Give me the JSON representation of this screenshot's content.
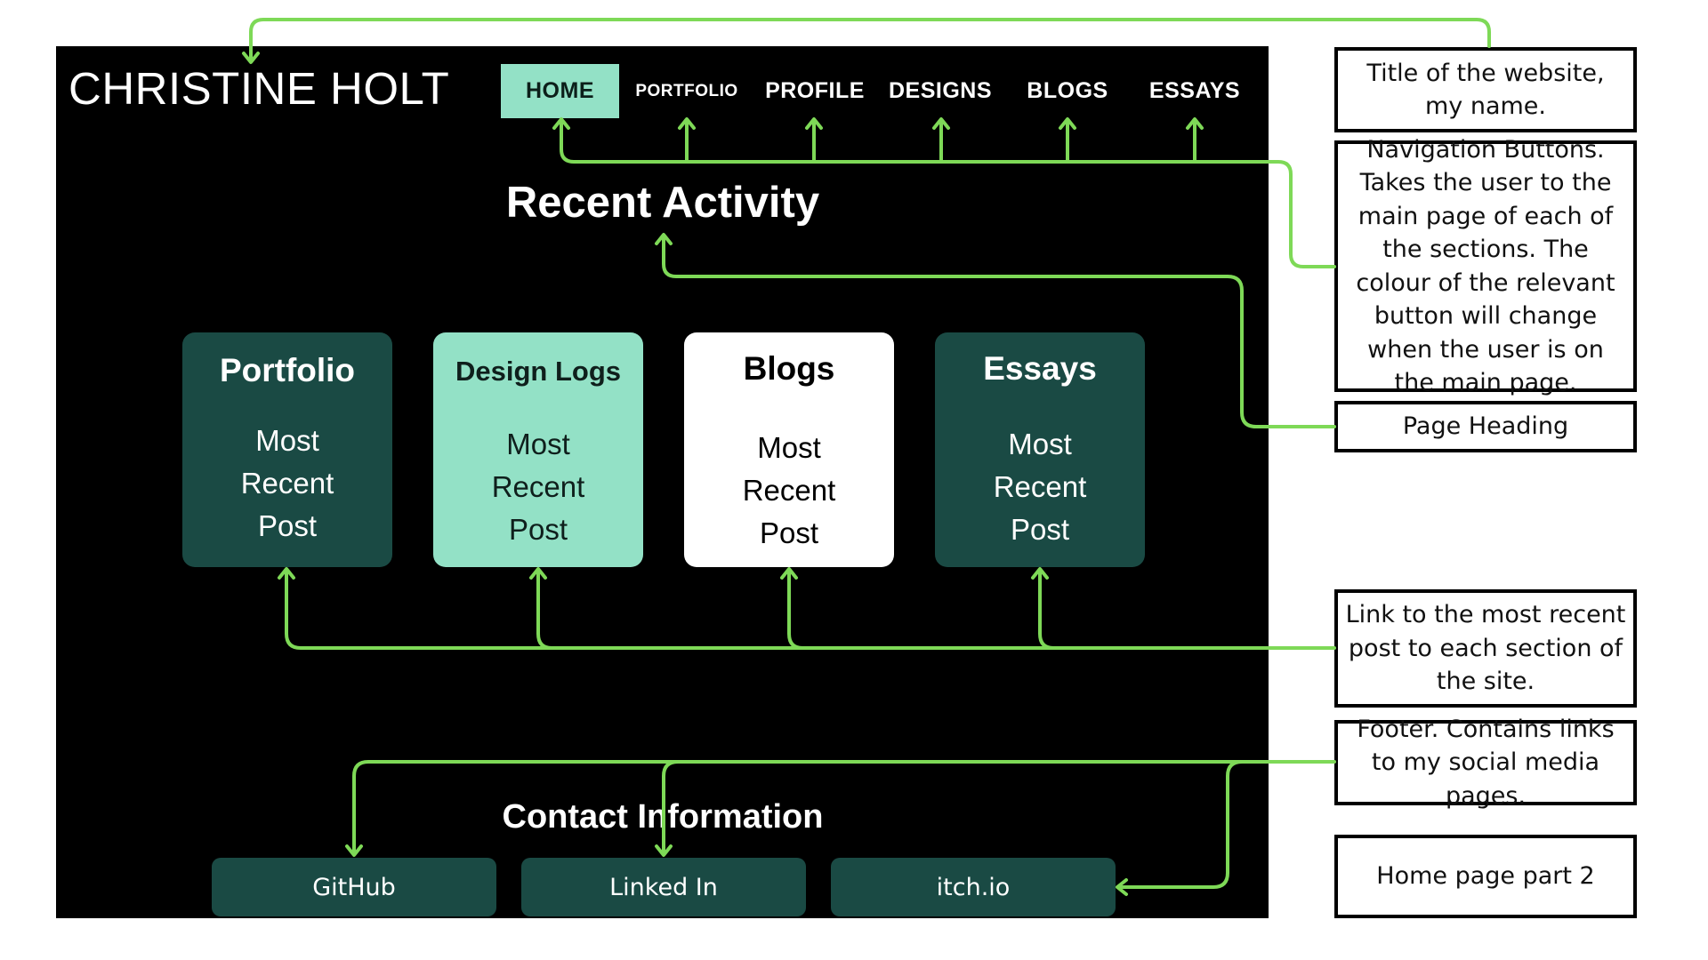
{
  "site": {
    "title": "CHRISTINE HOLT",
    "nav": [
      "HOME",
      "PORTFOLIO",
      "PROFILE",
      "DESIGNS",
      "BLOGS",
      "ESSAYS"
    ],
    "active_nav": "HOME",
    "heading": "Recent Activity",
    "cards": [
      {
        "title": "Portfolio",
        "lines": [
          "Most",
          "Recent",
          "Post"
        ],
        "style": "dark"
      },
      {
        "title": "Design Logs",
        "lines": [
          "Most",
          "Recent",
          "Post"
        ],
        "style": "mint"
      },
      {
        "title": "Blogs",
        "lines": [
          "Most",
          "Recent",
          "Post"
        ],
        "style": "white"
      },
      {
        "title": "Essays",
        "lines": [
          "Most",
          "Recent",
          "Post"
        ],
        "style": "dark"
      }
    ],
    "contact_heading": "Contact Information",
    "footer_links": [
      "GitHub",
      "Linked In",
      "itch.io"
    ]
  },
  "annotations": {
    "title_note": "Title of the website, my name.",
    "nav_note": "Navigation Buttons. Takes the user to the main page of each of the sections. The colour of the relevant button will change when the user is on the main page.",
    "heading_note": "Page Heading",
    "cards_note": "Link to the most recent post to each section of the site.",
    "footer_note": "Footer. Contains links to my social media pages.",
    "page_label": "Home page part 2"
  },
  "colors": {
    "background": "#000000",
    "accent_mint": "#93e1c6",
    "dark_teal": "#1a4a44",
    "connector_green": "#7ed957"
  }
}
